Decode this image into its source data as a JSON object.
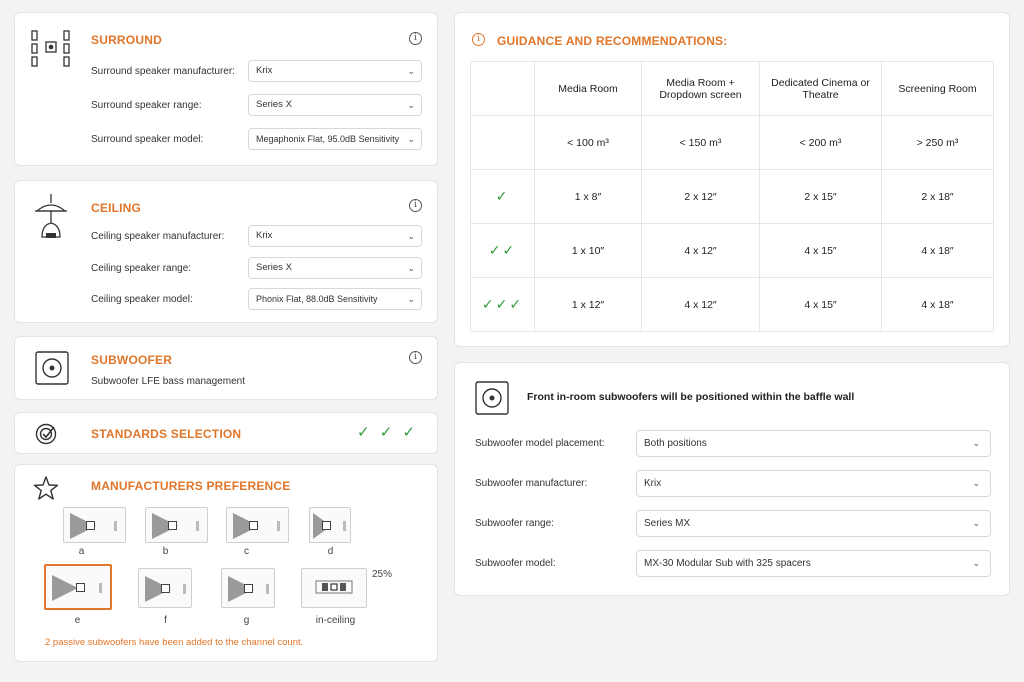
{
  "surround": {
    "title": "SURROUND",
    "info": "i",
    "rows": [
      {
        "label": "Surround speaker manufacturer:",
        "value": "Krix"
      },
      {
        "label": "Surround speaker range:",
        "value": "Series X"
      },
      {
        "label": "Surround speaker model:",
        "value": "Megaphonix Flat, 95.0dB Sensitivity"
      }
    ]
  },
  "ceiling": {
    "title": "CEILING",
    "info": "i",
    "rows": [
      {
        "label": "Ceiling speaker manufacturer:",
        "value": "Krix"
      },
      {
        "label": "Ceiling speaker range:",
        "value": "Series X"
      },
      {
        "label": "Ceiling speaker model:",
        "value": "Phonix Flat, 88.0dB Sensitivity"
      }
    ]
  },
  "subwoofer": {
    "title": "SUBWOOFER",
    "info": "i",
    "text": "Subwoofer LFE bass management"
  },
  "standards": {
    "title": "STANDARDS SELECTION",
    "checks": "✓ ✓ ✓"
  },
  "manufacturers": {
    "title": "MANUFACTURERS PREFERENCE",
    "options": [
      "a",
      "b",
      "c",
      "d",
      "e",
      "f",
      "g",
      "in-ceiling"
    ],
    "selected": "e",
    "percent": "25%",
    "note": "2 passive subwoofers have been added to the channel count."
  },
  "guidance": {
    "title": "GUIDANCE AND RECOMMENDATIONS:",
    "info": "i",
    "headers": [
      "",
      "Media Room",
      "Media Room + Dropdown screen",
      "Dedicated Cinema or Theatre",
      "Screening Room"
    ],
    "rows": [
      [
        "",
        "< 100 m³",
        "< 150 m³",
        "< 200 m³",
        "> 250 m³"
      ],
      [
        "✓",
        "1 x 8″",
        "2 x 12″",
        "2 x 15″",
        "2 x 18″"
      ],
      [
        "✓✓",
        "1 x 10″",
        "4 x 12″",
        "4 x 15″",
        "4 x 18″"
      ],
      [
        "✓✓✓",
        "1 x 12″",
        "4 x 12″",
        "4 x 15″",
        "4 x 18″"
      ]
    ]
  },
  "front_sub": {
    "heading": "Front in-room subwoofers will be positioned within the baffle wall",
    "rows": [
      {
        "label": "Subwoofer model placement:",
        "value": "Both positions"
      },
      {
        "label": "Subwoofer manufacturer:",
        "value": "Krix"
      },
      {
        "label": "Subwoofer range:",
        "value": "Series MX"
      },
      {
        "label": "Subwoofer model:",
        "value": "MX-30 Modular Sub with 325 spacers"
      }
    ]
  },
  "colors": {
    "accent": "#e0762a",
    "check": "#2d9b3a"
  }
}
